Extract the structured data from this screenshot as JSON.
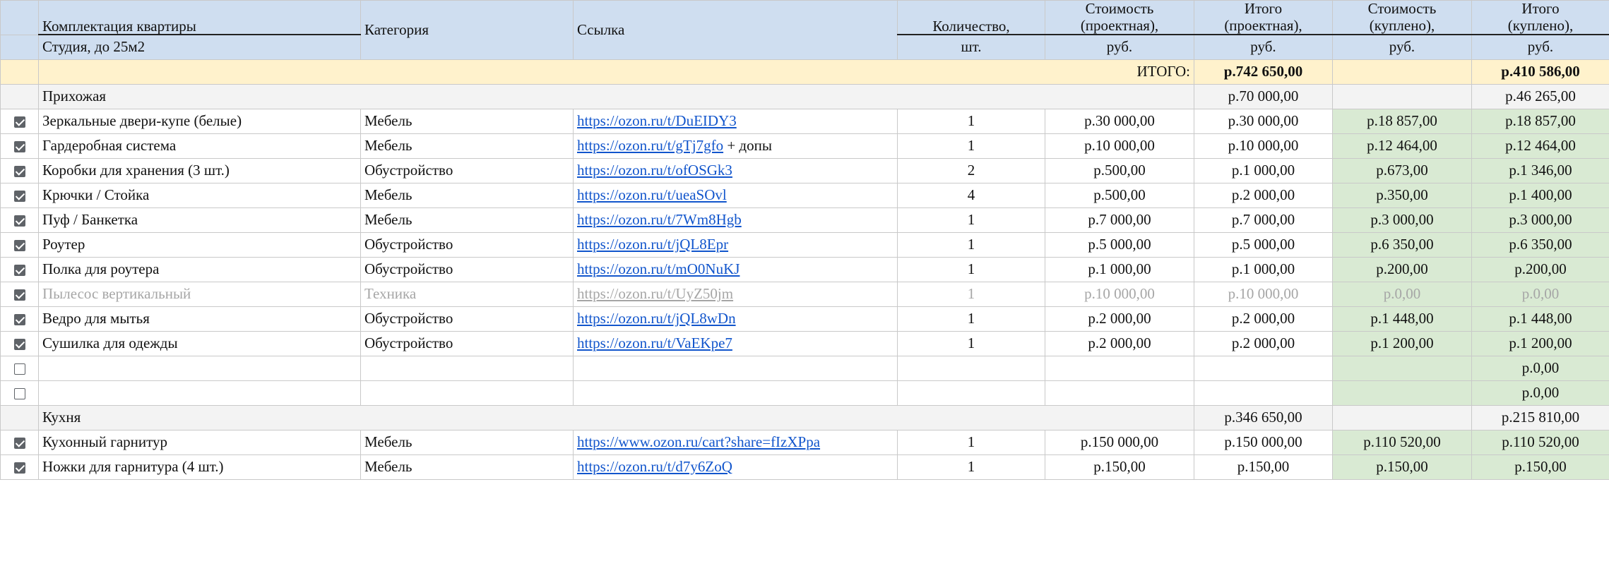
{
  "header": {
    "apartment": "Комплектация квартиры",
    "apartment_type": "Студия, до 25м2",
    "category": "Категория",
    "link": "Ссылка",
    "qty": "Количество,",
    "qty_unit": "шт.",
    "cost_proj_1": "Стоимость",
    "cost_proj_2": "(проектная),",
    "cost_proj_unit": "руб.",
    "total_proj_1": "Итого",
    "total_proj_2": "(проектная),",
    "total_proj_unit": "руб.",
    "cost_bought_1": "Стоимость",
    "cost_bought_2": "(куплено),",
    "cost_bought_unit": "руб.",
    "total_bought_1": "Итого",
    "total_bought_2": "(куплено),",
    "total_bought_unit": "руб."
  },
  "grand_total": {
    "label": "ИТОГО:",
    "projected": "р.742 650,00",
    "bought": "р.410 586,00"
  },
  "sections": [
    {
      "name": "Прихожая",
      "total_projected": "р.70 000,00",
      "total_bought": "р.46 265,00",
      "rows": [
        {
          "checked": true,
          "disabled": false,
          "item": "Зеркальные двери-купе (белые)",
          "category": "Мебель",
          "link": "https://ozon.ru/t/DuEIDY3",
          "link_suffix": "",
          "qty": "1",
          "cost": "р.30 000,00",
          "total": "р.30 000,00",
          "bought_cost": "р.18 857,00",
          "bought_total": "р.18 857,00"
        },
        {
          "checked": true,
          "disabled": false,
          "item": "Гардеробная система",
          "category": "Мебель",
          "link": "https://ozon.ru/t/gTj7gfo",
          "link_suffix": " + допы",
          "qty": "1",
          "cost": "р.10 000,00",
          "total": "р.10 000,00",
          "bought_cost": "р.12 464,00",
          "bought_total": "р.12 464,00"
        },
        {
          "checked": true,
          "disabled": false,
          "item": "Коробки для хранения (3 шт.)",
          "category": "Обустройство",
          "link": "https://ozon.ru/t/ofOSGk3",
          "link_suffix": "",
          "qty": "2",
          "cost": "р.500,00",
          "total": "р.1 000,00",
          "bought_cost": "р.673,00",
          "bought_total": "р.1 346,00"
        },
        {
          "checked": true,
          "disabled": false,
          "item": "Крючки / Стойка",
          "category": "Мебель",
          "link": "https://ozon.ru/t/ueaSOvl",
          "link_suffix": "",
          "qty": "4",
          "cost": "р.500,00",
          "total": "р.2 000,00",
          "bought_cost": "р.350,00",
          "bought_total": "р.1 400,00"
        },
        {
          "checked": true,
          "disabled": false,
          "item": "Пуф / Банкетка",
          "category": "Мебель",
          "link": "https://ozon.ru/t/7Wm8Hgb",
          "link_suffix": "",
          "qty": "1",
          "cost": "р.7 000,00",
          "total": "р.7 000,00",
          "bought_cost": "р.3 000,00",
          "bought_total": "р.3 000,00"
        },
        {
          "checked": true,
          "disabled": false,
          "item": "Роутер",
          "category": "Обустройство",
          "link": "https://ozon.ru/t/jQL8Epr",
          "link_suffix": "",
          "qty": "1",
          "cost": "р.5 000,00",
          "total": "р.5 000,00",
          "bought_cost": "р.6 350,00",
          "bought_total": "р.6 350,00"
        },
        {
          "checked": true,
          "disabled": false,
          "item": "Полка для роутера",
          "category": "Обустройство",
          "link": "https://ozon.ru/t/mO0NuKJ",
          "link_suffix": "",
          "qty": "1",
          "cost": "р.1 000,00",
          "total": "р.1 000,00",
          "bought_cost": "р.200,00",
          "bought_total": "р.200,00"
        },
        {
          "checked": true,
          "disabled": true,
          "item": "Пылесос вертикальный",
          "category": "Техника",
          "link": "https://ozon.ru/t/UyZ50jm",
          "link_suffix": "",
          "qty": "1",
          "cost": "р.10 000,00",
          "total": "р.10 000,00",
          "bought_cost": "р.0,00",
          "bought_total": "р.0,00"
        },
        {
          "checked": true,
          "disabled": false,
          "item": "Ведро для мытья",
          "category": "Обустройство",
          "link": "https://ozon.ru/t/jQL8wDn",
          "link_suffix": "",
          "qty": "1",
          "cost": "р.2 000,00",
          "total": "р.2 000,00",
          "bought_cost": "р.1 448,00",
          "bought_total": "р.1 448,00"
        },
        {
          "checked": true,
          "disabled": false,
          "item": "Сушилка для одежды",
          "category": "Обустройство",
          "link": "https://ozon.ru/t/VaEKpe7",
          "link_suffix": "",
          "qty": "1",
          "cost": "р.2 000,00",
          "total": "р.2 000,00",
          "bought_cost": "р.1 200,00",
          "bought_total": "р.1 200,00"
        },
        {
          "checked": false,
          "disabled": false,
          "item": "",
          "category": "",
          "link": "",
          "link_suffix": "",
          "qty": "",
          "cost": "",
          "total": "",
          "bought_cost": "",
          "bought_total": "р.0,00"
        },
        {
          "checked": false,
          "disabled": false,
          "item": "",
          "category": "",
          "link": "",
          "link_suffix": "",
          "qty": "",
          "cost": "",
          "total": "",
          "bought_cost": "",
          "bought_total": "р.0,00"
        }
      ]
    },
    {
      "name": "Кухня",
      "total_projected": "р.346 650,00",
      "total_bought": "р.215 810,00",
      "rows": [
        {
          "checked": true,
          "disabled": false,
          "item": "Кухонный гарнитур",
          "category": "Мебель",
          "link": "https://www.ozon.ru/cart?share=fIzXPpa",
          "link_suffix": "",
          "qty": "1",
          "cost": "р.150 000,00",
          "total": "р.150 000,00",
          "bought_cost": "р.110 520,00",
          "bought_total": "р.110 520,00"
        },
        {
          "checked": true,
          "disabled": false,
          "item": "Ножки для гарнитура (4 шт.)",
          "category": "Мебель",
          "link": "https://ozon.ru/t/d7y6ZoQ",
          "link_suffix": "",
          "qty": "1",
          "cost": "р.150,00",
          "total": "р.150,00",
          "bought_cost": "р.150,00",
          "bought_total": "р.150,00"
        }
      ]
    }
  ]
}
